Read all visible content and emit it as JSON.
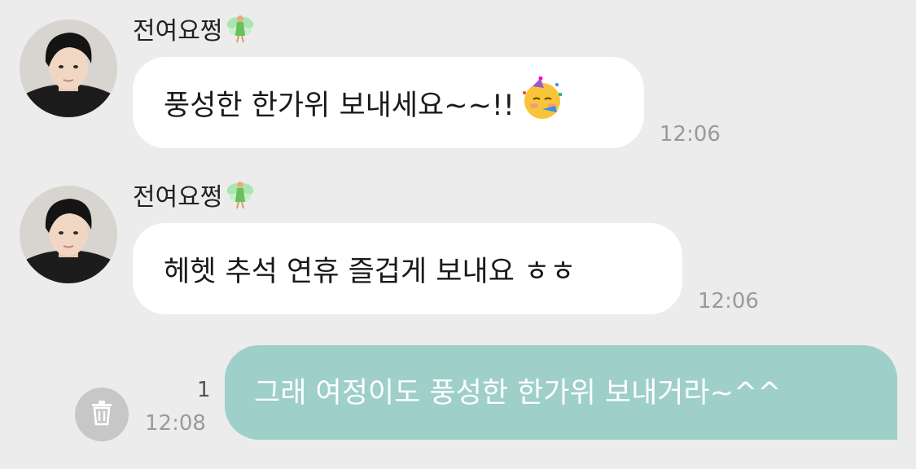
{
  "messages": [
    {
      "sender": "전여요쩡",
      "sender_emoji": "fairy-icon",
      "text": "풍성한 한가위 보내세요~~!!",
      "trailing_emoji": "partying-face-icon",
      "time": "12:06"
    },
    {
      "sender": "전여요쩡",
      "sender_emoji": "fairy-icon",
      "text": "헤헷 추석 연휴 즐겁게 보내요 ㅎㅎ",
      "time": "12:06"
    }
  ],
  "my_message": {
    "text": "그래 여정이도 풍성한 한가위 보내거라~^^",
    "unread_count": "1",
    "time": "12:08"
  },
  "colors": {
    "background": "#ececec",
    "incoming_bubble": "#ffffff",
    "outgoing_bubble": "#9ecfc9",
    "timestamp": "#9a9a9a"
  },
  "icons": {
    "delete": "trash-icon"
  }
}
